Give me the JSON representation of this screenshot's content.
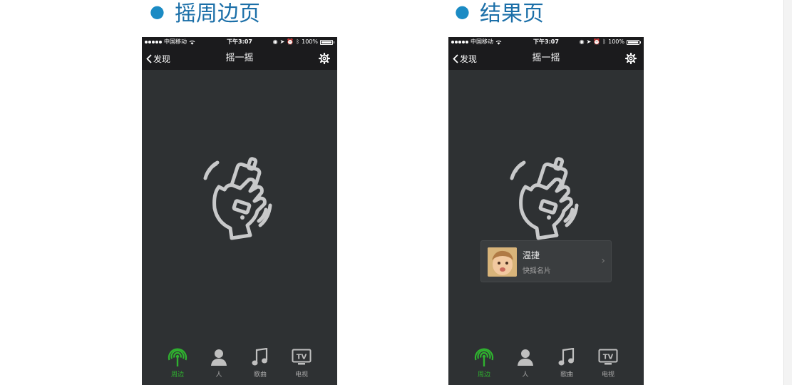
{
  "sections": [
    {
      "title": "摇周边页"
    },
    {
      "title": "结果页"
    }
  ],
  "status": {
    "carrier": "中国移动",
    "time": "下午3:07",
    "battery": "100%"
  },
  "nav": {
    "back_label": "发现",
    "title": "摇一摇"
  },
  "tabs": [
    {
      "label": "周边",
      "icon": "radar-icon",
      "active": true
    },
    {
      "label": "人",
      "icon": "person-icon",
      "active": false
    },
    {
      "label": "歌曲",
      "icon": "music-note-icon",
      "active": false
    },
    {
      "label": "电视",
      "icon": "tv-icon",
      "active": false
    }
  ],
  "result_card": {
    "name": "温捷",
    "subtitle": "快摇名片"
  },
  "colors": {
    "accent_green": "#2fb22f",
    "title_blue": "#1b6fa8",
    "background": "#2e3133",
    "bar": "#1b1b1d"
  }
}
